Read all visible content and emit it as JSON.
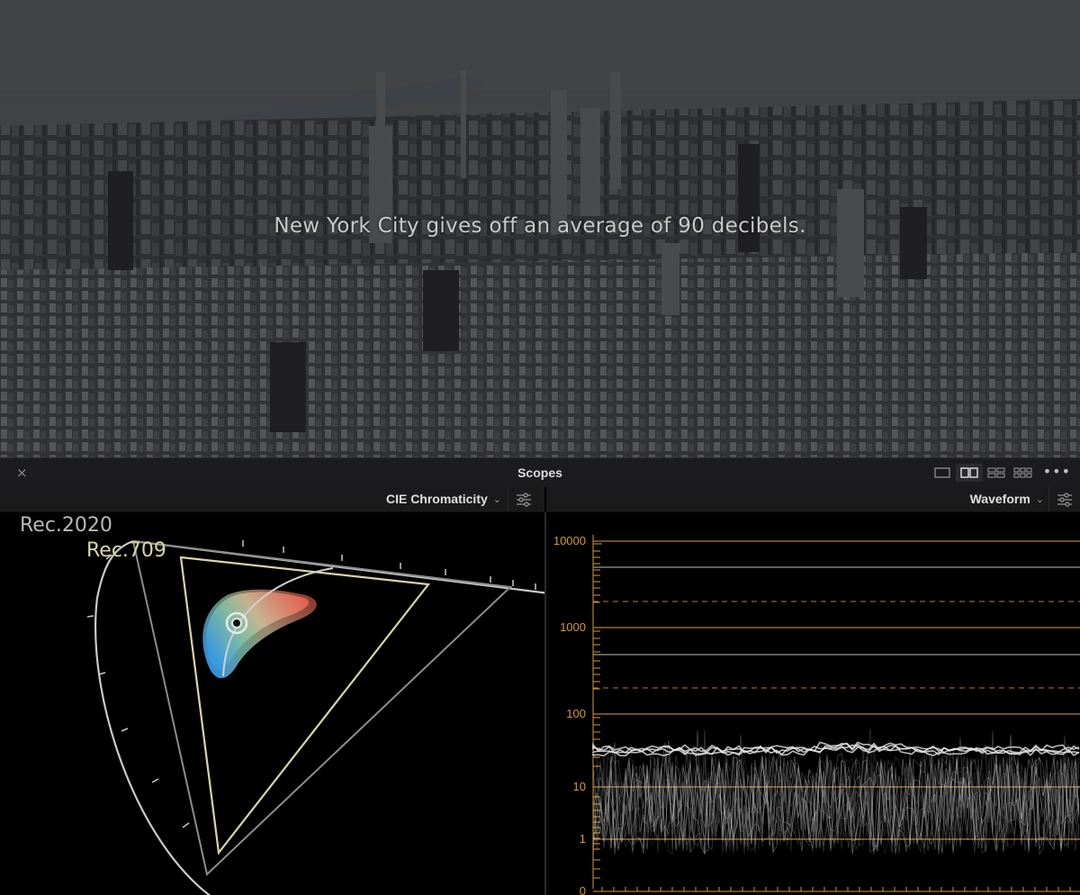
{
  "viewer": {
    "caption": "New York City gives off an average of 90 decibels."
  },
  "scopes_panel": {
    "title": "Scopes",
    "close_glyph": "×",
    "more_glyph": "•••",
    "layout_buttons": [
      {
        "icon": "single-layout-icon",
        "active": false
      },
      {
        "icon": "dual-layout-icon",
        "active": true
      },
      {
        "icon": "quad-layout-icon",
        "active": false
      },
      {
        "icon": "multi-layout-icon",
        "active": false
      }
    ],
    "left_scope": {
      "selected": "CIE Chromaticity",
      "gamut_labels": {
        "outer": "Rec.2020",
        "inner": "Rec.709"
      }
    },
    "right_scope": {
      "selected": "Waveform",
      "y_axis_labels": [
        "10000",
        "1000",
        "100",
        "10",
        "1",
        "0"
      ]
    }
  },
  "colors": {
    "accent_orange": "#d49a2c",
    "rec709": "#d8d4a6",
    "rec2020": "#b9b9b9",
    "panel_bg": "#1c1c1e"
  }
}
